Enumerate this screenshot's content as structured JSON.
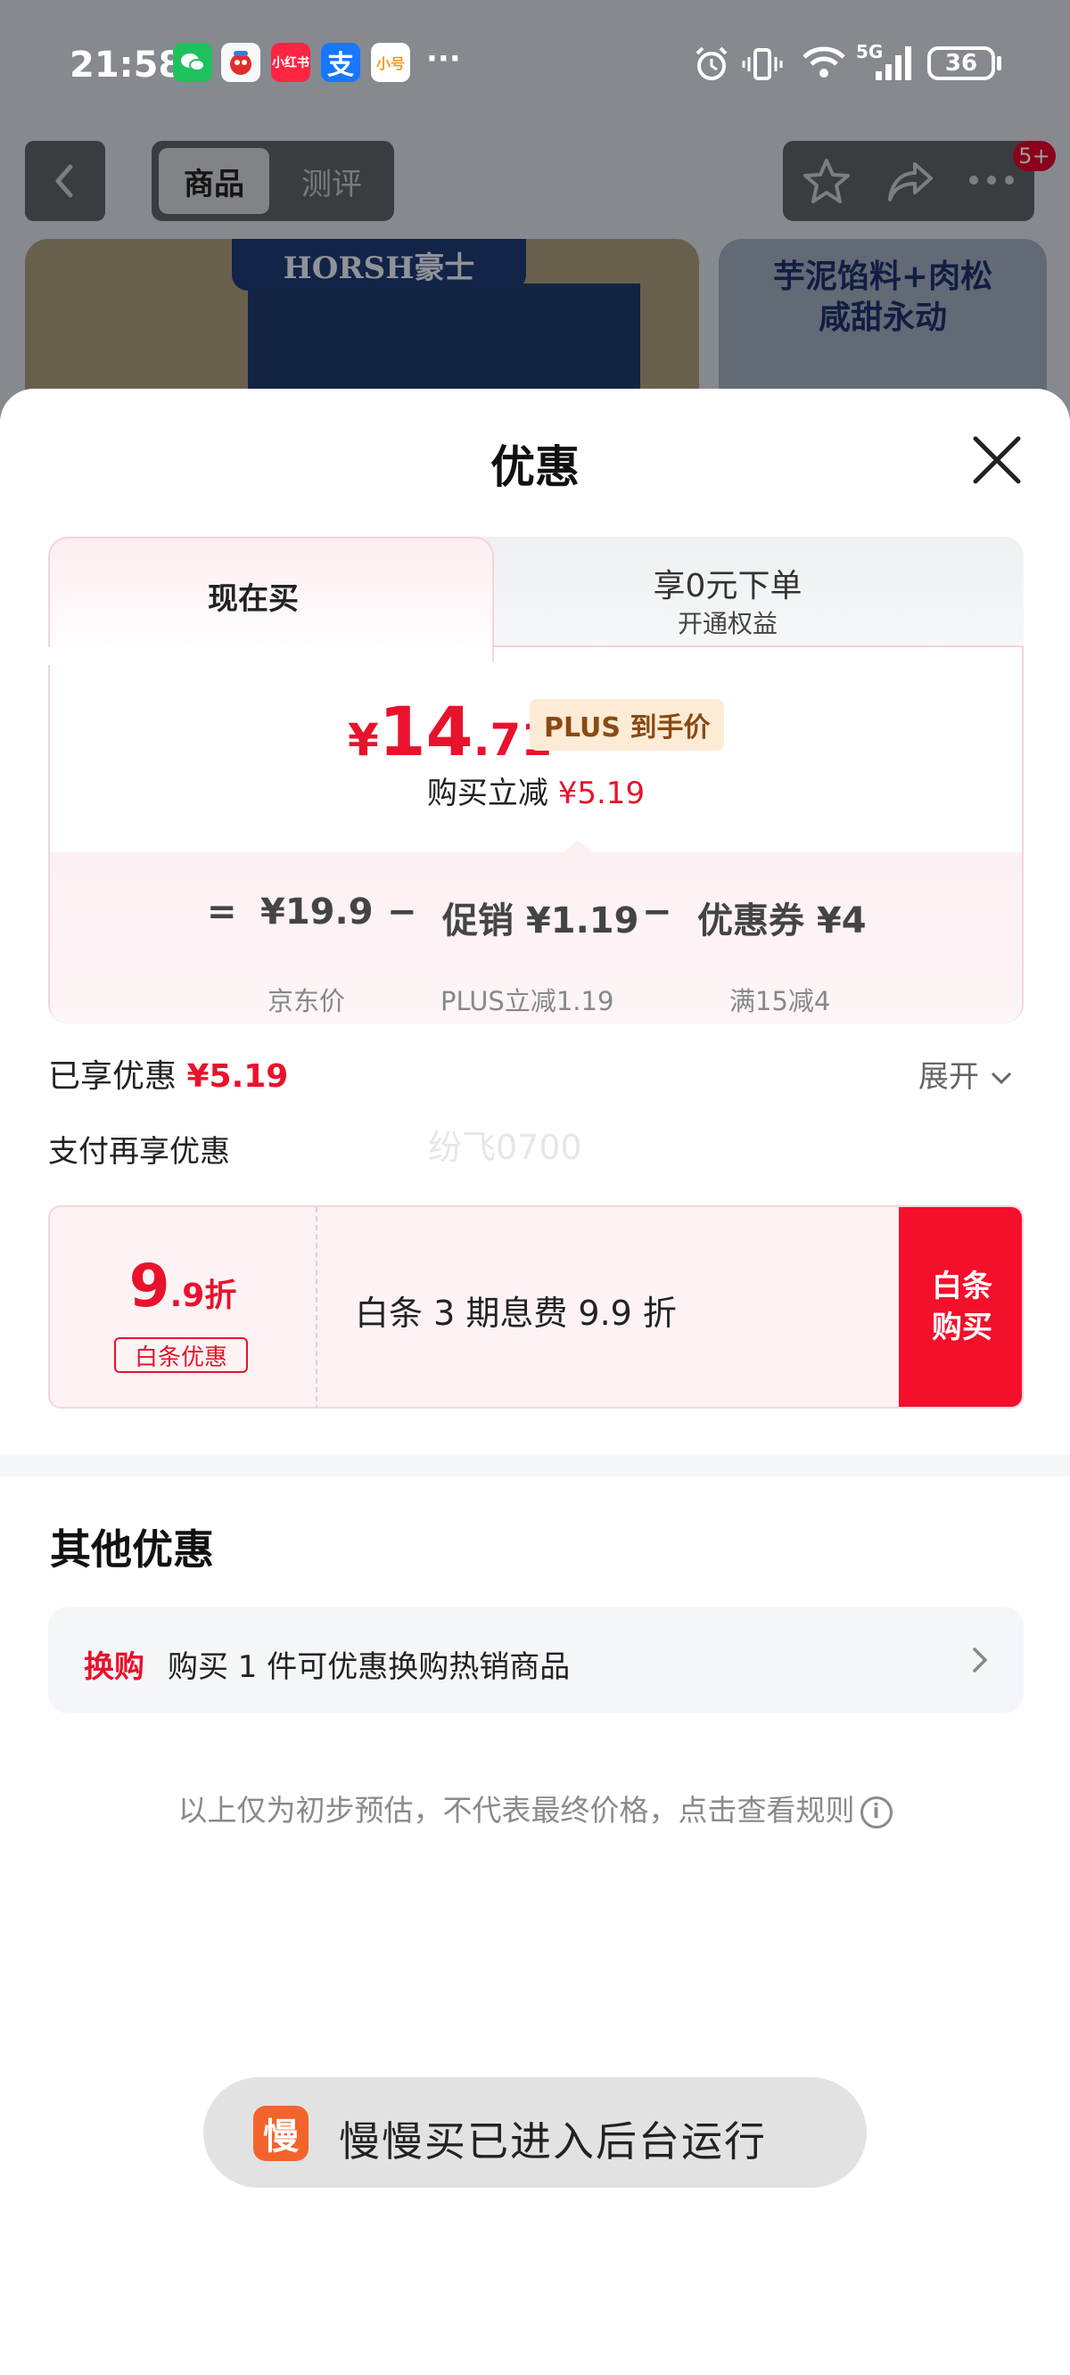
{
  "status_bar": {
    "time": "21:58",
    "app_icons": [
      "wechat-icon",
      "mascot-icon",
      "xiaohongshu-icon",
      "alipay-icon",
      "xiaohao-icon"
    ],
    "xiaohongshu_label": "小红书",
    "alipay_label": "支",
    "xiaohao_label": "小号",
    "more": "···",
    "network": "5G",
    "battery": "36"
  },
  "background_page": {
    "tabs": [
      "商品",
      "测评"
    ],
    "badge": "5+",
    "brand": "HORSH豪士",
    "promo_text": [
      "芋泥馅料+肉松",
      "咸甜永动"
    ]
  },
  "sheet": {
    "title": "优惠",
    "tabs": {
      "left": "现在买",
      "right": "享0元下单",
      "right_sub": "开通权益"
    },
    "price": {
      "yen": "¥",
      "int": "14",
      "dec": ".71",
      "tag": "PLUS 到手价",
      "reduce_label": "购买立减",
      "reduce_amount": "¥5.19"
    },
    "formula": {
      "eq": "=",
      "base": "¥19.9",
      "minus1": "−",
      "promo": "促销 ¥1.19",
      "minus2": "−",
      "coupon": "优惠券 ¥4",
      "base_label": "京东价",
      "promo_label": "PLUS立减1.19",
      "coupon_label": "满15减4"
    },
    "enjoyed": {
      "label": "已享优惠",
      "amount": "¥5.19",
      "expand": "展开"
    },
    "pay_title": "支付再享优惠",
    "watermark": "纷飞0700",
    "baitiao": {
      "disc_big": "9",
      "disc_small": ".9折",
      "tag": "白条优惠",
      "text": "白条 3 期息费 9.9 折",
      "buy_line1": "白条",
      "buy_line2": "购买"
    },
    "other": {
      "title": "其他优惠",
      "tag": "换购",
      "text": "购买 1 件可优惠换购热销商品"
    },
    "disclaimer": "以上仅为初步预估，不代表最终价格，点击查看规则"
  },
  "toast": {
    "icon": "慢",
    "text": "慢慢买已进入后台运行"
  }
}
